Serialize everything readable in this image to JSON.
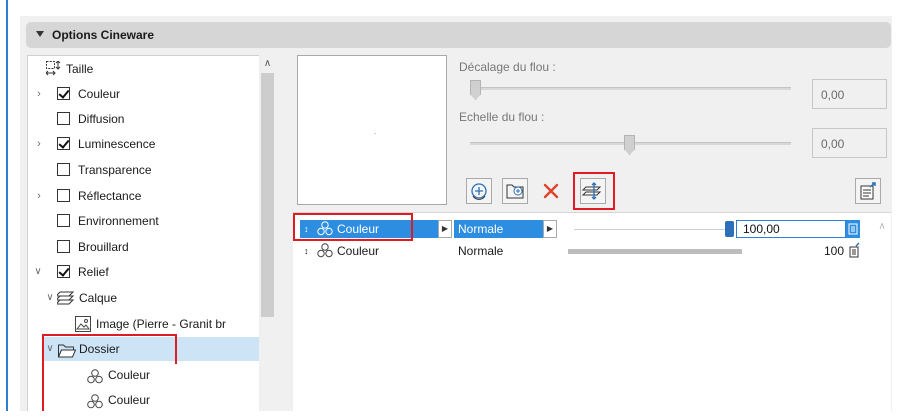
{
  "header": {
    "title": "Options Cineware"
  },
  "tree": {
    "items": [
      {
        "label": "Taille",
        "icon": "size-icon",
        "checkbox": null,
        "expander": null
      },
      {
        "label": "Couleur",
        "icon": null,
        "checkbox": true,
        "expander": "collapsed"
      },
      {
        "label": "Diffusion",
        "icon": null,
        "checkbox": false,
        "expander": null
      },
      {
        "label": "Luminescence",
        "icon": null,
        "checkbox": true,
        "expander": "collapsed"
      },
      {
        "label": "Transparence",
        "icon": null,
        "checkbox": false,
        "expander": null
      },
      {
        "label": "Réflectance",
        "icon": null,
        "checkbox": false,
        "expander": "collapsed"
      },
      {
        "label": "Environnement",
        "icon": null,
        "checkbox": false,
        "expander": null
      },
      {
        "label": "Brouillard",
        "icon": null,
        "checkbox": false,
        "expander": null
      },
      {
        "label": "Relief",
        "icon": null,
        "checkbox": true,
        "expander": "expanded"
      },
      {
        "label": "Calque",
        "icon": "layers-icon",
        "checkbox": null,
        "expander": "expanded"
      },
      {
        "label": "Image (Pierre - Granit br",
        "icon": "image-icon",
        "checkbox": null,
        "expander": null
      },
      {
        "label": "Dossier",
        "icon": "folder-icon",
        "checkbox": null,
        "expander": "expanded"
      },
      {
        "label": "Couleur",
        "icon": "shader-icon",
        "checkbox": null,
        "expander": null
      },
      {
        "label": "Couleur",
        "icon": "shader-icon",
        "checkbox": null,
        "expander": null
      }
    ]
  },
  "blur": {
    "offset_label": "Décalage du flou :",
    "offset_value": "0,00",
    "scale_label": "Echelle du flou :",
    "scale_value": "0,00"
  },
  "toolbar": {
    "buttons": [
      "add-shader-icon",
      "add-folder-icon",
      "delete-icon",
      "swap-icon"
    ],
    "right_button": "export-icon"
  },
  "layers": [
    {
      "name": "Couleur",
      "mode": "Normale",
      "value": "100,00",
      "selected": true
    },
    {
      "name": "Couleur",
      "mode": "Normale",
      "value": "100",
      "selected": false
    }
  ],
  "colors": {
    "highlight": "#2d8de1",
    "callout": "#e01b24",
    "selection": "#cde4f7",
    "accent": "#2f7fd0"
  }
}
